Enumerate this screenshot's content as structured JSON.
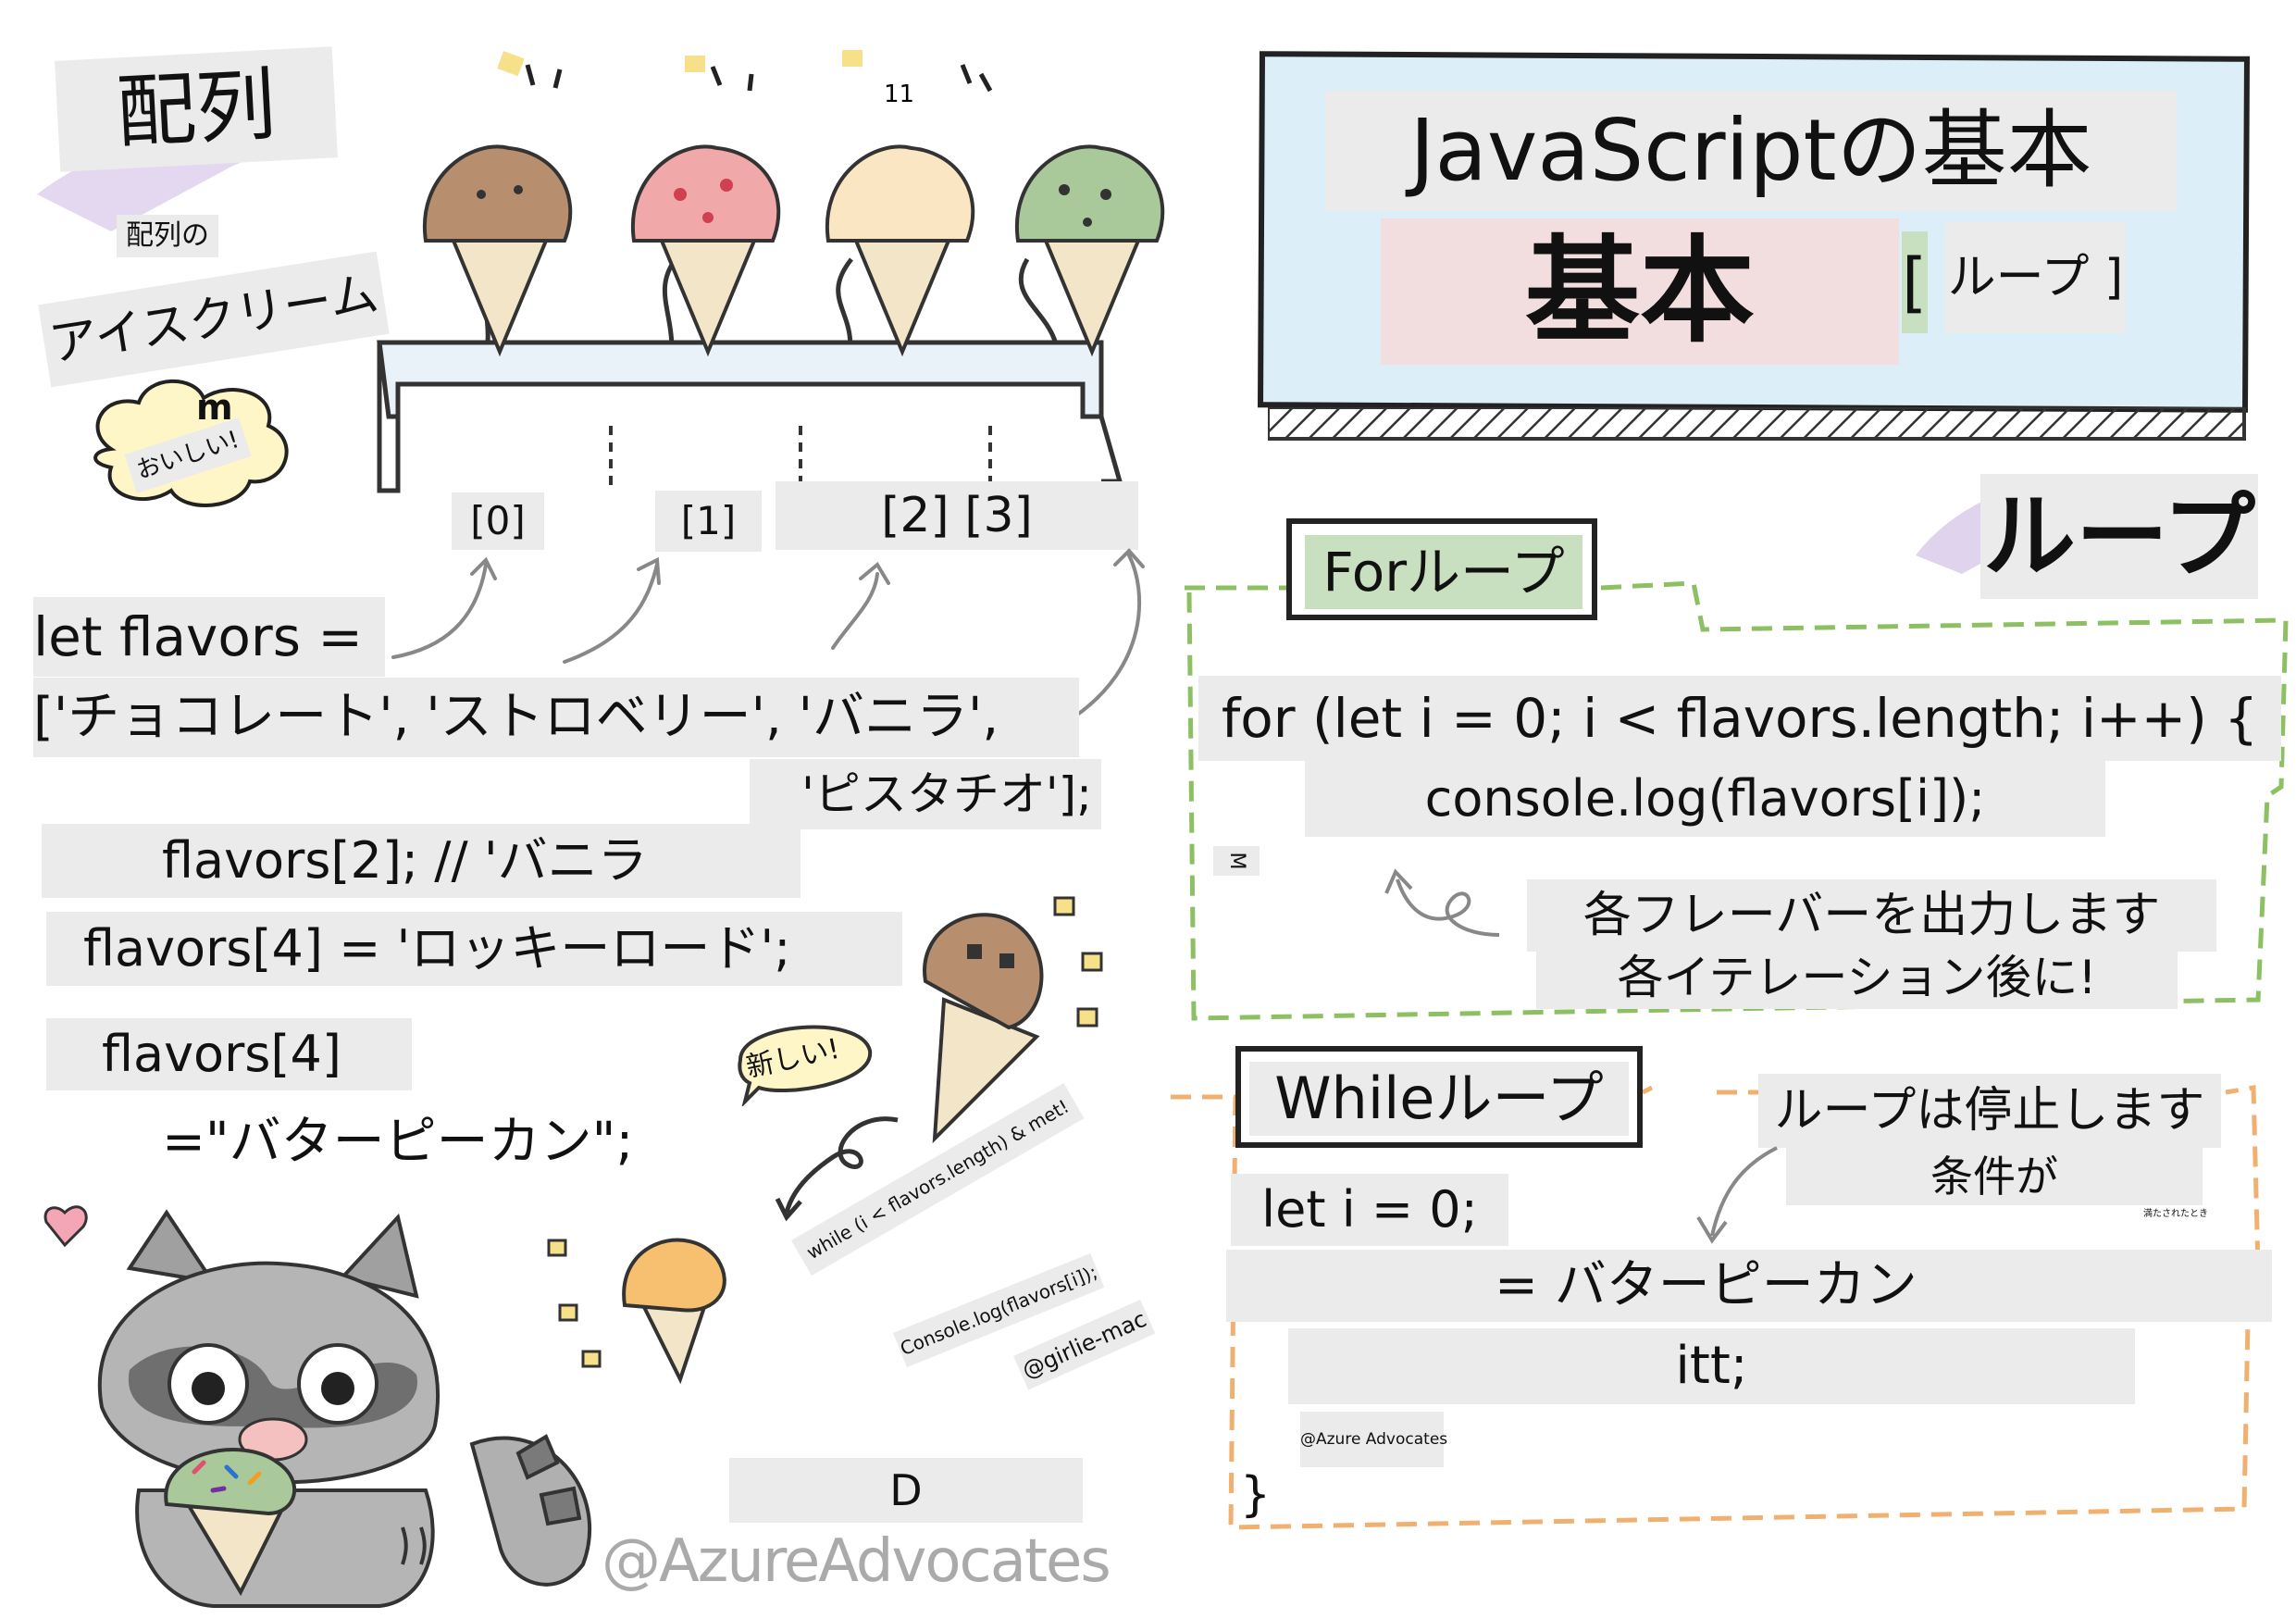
{
  "arrays": {
    "title": "配列",
    "subtitle_small": "配列の",
    "subtitle_big": "アイスクリーム",
    "cloud_m": "m",
    "cloud_text": "おいしい!",
    "top_number": "11",
    "indices": [
      "[0]",
      "[1]",
      "[2] [3]"
    ],
    "code_let": "let flavors =",
    "code_array_line1": "['チョコレート', 'ストロベリー', 'バニラ',",
    "code_array_line2": "'ピスタチオ'];",
    "code_access": "flavors[2]; // 'バニラ",
    "code_assign": "flavors[4] = 'ロッキーロード';",
    "code_flavor4": "flavors[4]",
    "code_flavor4_value": "=\"バターピーカン\";",
    "bubble_new": "新しい!",
    "note_while": "while (i < flavors.length) & met!",
    "note_console": "Console.log(flavors[i]);",
    "note_handle": "@girlie-mac",
    "d_label": "D",
    "signature": "@AzureAdvocates"
  },
  "header": {
    "title": "JavaScriptの基本",
    "subtitle": "基本",
    "bracket_left": "[",
    "loop_tag": "ループ ]"
  },
  "loops": {
    "title": "ループ",
    "for_title": "Forループ",
    "for_line1": "for (let i = 0; i < flavors.length; i++) {",
    "for_line2": "console.log(flavors[i]);",
    "for_m": "M",
    "for_note1": "各フレーバーを出力します",
    "for_note2": "各イテレーション後に!",
    "while_title": "Whileループ",
    "while_note1": "ループは停止します",
    "while_note2": "条件が",
    "while_tiny": "満たされたとき",
    "while_line1": "let i = 0;",
    "while_line2": "= バターピーカン",
    "while_line3": "itt;",
    "azure_small": "@Azure Advocates",
    "close_brace": "}"
  },
  "colors": {
    "chocolate": "#b88f6e",
    "strawberry": "#f0a8a8",
    "vanilla": "#fbe6c4",
    "pistachio": "#a9c99a",
    "for_dash": "#8cc063",
    "while_dash": "#f0b070",
    "header_blue": "#dceef8",
    "pink_box": "#f2dede",
    "green_box": "#c8e0c0"
  }
}
